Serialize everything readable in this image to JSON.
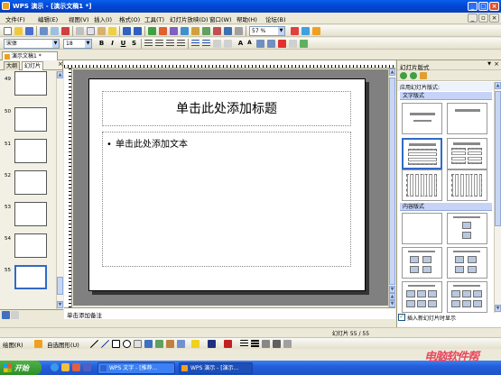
{
  "window": {
    "title": "WPS 演示 - [演示文稿1 *]"
  },
  "menu": [
    {
      "label": "文件(F)"
    },
    {
      "label": "编辑(E)"
    },
    {
      "label": "视图(V)"
    },
    {
      "label": "插入(I)"
    },
    {
      "label": "格式(O)"
    },
    {
      "label": "工具(T)"
    },
    {
      "label": "幻灯片放映(D)"
    },
    {
      "label": "窗口(W)"
    },
    {
      "label": "帮助(H)"
    },
    {
      "label": "论坛(B)"
    }
  ],
  "toolbar": {
    "zoom": "57 %",
    "font": "宋体",
    "font_size": "18"
  },
  "doc_tab": {
    "label": "演示文稿1 *"
  },
  "left_panel": {
    "tabs": [
      {
        "label": "大纲"
      },
      {
        "label": "幻灯片"
      }
    ],
    "thumbnails": [
      {
        "num": "49"
      },
      {
        "num": "50"
      },
      {
        "num": "51"
      },
      {
        "num": "52"
      },
      {
        "num": "53"
      },
      {
        "num": "54"
      },
      {
        "num": "55"
      }
    ]
  },
  "slide": {
    "title_placeholder": "单击此处添加标题",
    "body_placeholder": "单击此处添加文本",
    "bullet": "•"
  },
  "notes": {
    "placeholder": "单击添加备注"
  },
  "task_pane": {
    "title": "幻灯片版式",
    "subtitle": "应用幻灯片版式:",
    "section_text": "文字版式",
    "section_content": "内容版式",
    "show_on_insert": "插入新幻灯片时显示"
  },
  "status": {
    "slide_pos": "幻灯片 55 / 55"
  },
  "drawbar": {
    "draw": "绘图(R)",
    "autoshape": "自选图形(U)"
  },
  "taskbar": {
    "start": "开始",
    "buttons": [
      {
        "label": "WPS 文字 - [推荐..."
      },
      {
        "label": "WPS 演示 - [演示..."
      }
    ]
  },
  "watermark": "电脑软件帮"
}
